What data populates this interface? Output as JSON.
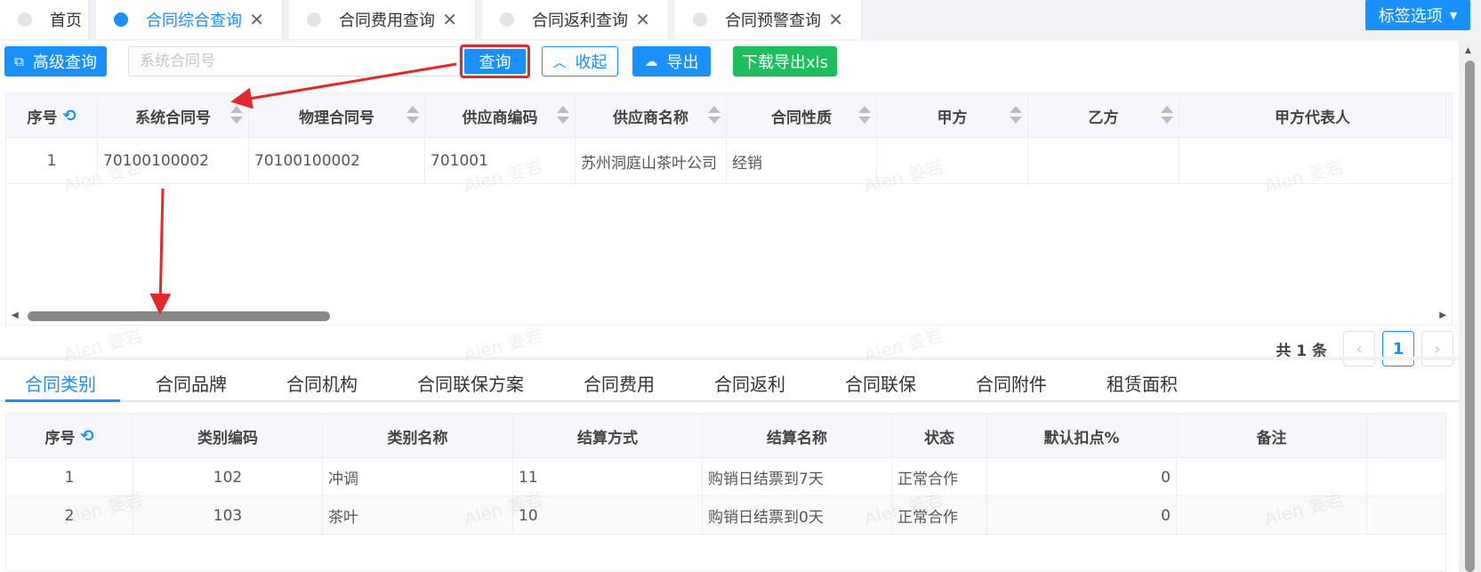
{
  "tabs": [
    {
      "label": "首页",
      "closable": false,
      "active": false
    },
    {
      "label": "合同综合查询",
      "closable": true,
      "active": true
    },
    {
      "label": "合同费用查询",
      "closable": true,
      "active": false
    },
    {
      "label": "合同返利查询",
      "closable": true,
      "active": false
    },
    {
      "label": "合同预警查询",
      "closable": true,
      "active": false
    }
  ],
  "tab_options": {
    "label": "标签选项"
  },
  "toolbar": {
    "advanced_search": "高级查询",
    "search_placeholder": "系统合同号",
    "query": "查询",
    "collapse": "收起",
    "export": "导出",
    "download_xls": "下载导出xls"
  },
  "upper_table": {
    "columns": [
      "序号",
      "系统合同号",
      "物理合同号",
      "供应商编码",
      "供应商名称",
      "合同性质",
      "甲方",
      "乙方",
      "甲方代表人"
    ],
    "rows": [
      [
        "1",
        "70100100002",
        "70100100002",
        "701001",
        "苏州洞庭山茶叶公司",
        "经销",
        "",
        "",
        ""
      ]
    ]
  },
  "pager": {
    "total": "共 1 条",
    "prev": "‹",
    "page": "1",
    "next": "›"
  },
  "sub_tabs": [
    "合同类别",
    "合同品牌",
    "合同机构",
    "合同联保方案",
    "合同费用",
    "合同返利",
    "合同联保",
    "合同附件",
    "租赁面积"
  ],
  "lower_table": {
    "columns": [
      "序号",
      "类别编码",
      "类别名称",
      "结算方式",
      "结算名称",
      "状态",
      "默认扣点%",
      "备注"
    ],
    "rows": [
      [
        "1",
        "102",
        "冲调",
        "11",
        "购销日结票到7天",
        "正常合作",
        "0",
        ""
      ],
      [
        "2",
        "103",
        "茶叶",
        "10",
        "购销日结票到0天",
        "正常合作",
        "0",
        ""
      ]
    ]
  },
  "watermark": "Alen 姜岩",
  "colors": {
    "primary": "#1890ff",
    "highlight": "#e8262a",
    "green": "#1bbf5c"
  }
}
